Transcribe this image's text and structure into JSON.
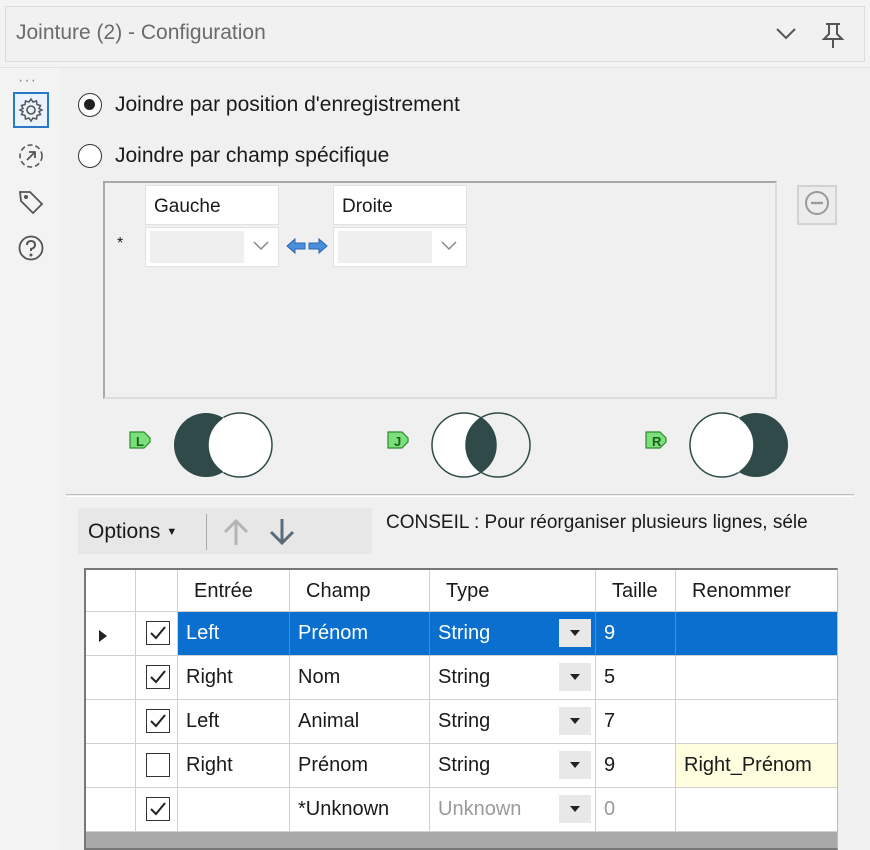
{
  "window": {
    "title": "Jointure (2) - Configuration"
  },
  "sidebar": {
    "more": "···",
    "items": [
      "gear-icon",
      "connection-icon",
      "tag-icon",
      "help-icon"
    ]
  },
  "join_mode": {
    "option_position": "Joindre par position d'enregistrement",
    "option_field": "Joindre par champ spécifique",
    "selected": "position"
  },
  "field_grid": {
    "left_header": "Gauche",
    "right_header": "Droite",
    "new_row_marker": "*"
  },
  "venn": {
    "left_label": "L",
    "join_label": "J",
    "right_label": "R"
  },
  "toolbar": {
    "options_label": "Options"
  },
  "hint": "CONSEIL : Pour réorganiser plusieurs lignes, séle",
  "table": {
    "headers": {
      "input": "Entrée",
      "field": "Champ",
      "type": "Type",
      "size": "Taille",
      "rename": "Renommer"
    },
    "rows": [
      {
        "checked": true,
        "input": "Left",
        "field": "Prénom",
        "type": "String",
        "size": "9",
        "rename": ""
      },
      {
        "checked": true,
        "input": "Right",
        "field": "Nom",
        "type": "String",
        "size": "5",
        "rename": ""
      },
      {
        "checked": true,
        "input": "Left",
        "field": "Animal",
        "type": "String",
        "size": "7",
        "rename": ""
      },
      {
        "checked": false,
        "input": "Right",
        "field": "Prénom",
        "type": "String",
        "size": "9",
        "rename": "Right_Prénom"
      },
      {
        "checked": true,
        "input": "",
        "field": "*Unknown",
        "type": "Unknown",
        "size": "0",
        "rename": ""
      }
    ]
  },
  "colors": {
    "selection": "#0a6fcf",
    "accent": "#2a78c8",
    "venn_fill": "#2f4a48",
    "tag_green": "#6fdc6f"
  }
}
